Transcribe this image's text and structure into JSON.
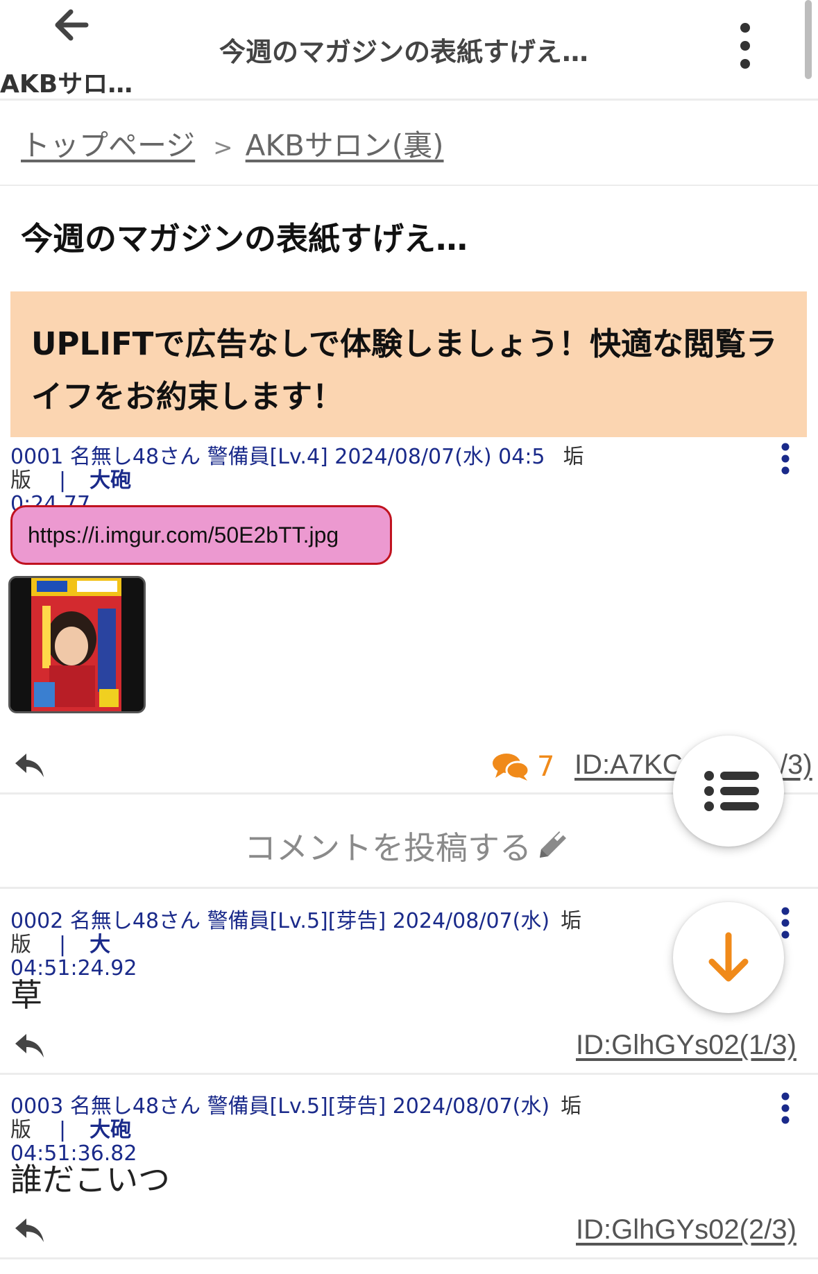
{
  "header": {
    "back_label": "AKBサロ…",
    "title": "今週のマガジンの表紙すげえ…"
  },
  "breadcrumb": {
    "home": "トップページ",
    "separator": ">",
    "board": "AKBサロン(裏)"
  },
  "thread": {
    "title": "今週のマガジンの表紙すげえ…"
  },
  "ad": {
    "text": "UPLIFTで広告なしで体験しましょう！快適な閲覧ライフをお約束します！"
  },
  "posts": [
    {
      "meta_line1": "0001 名無し48さん 警備員[Lv.4] 2024/08/07(水) 04:5",
      "meta_line2": "0:24.77",
      "ban": "垢版",
      "pipe": "|",
      "cannon": "大砲",
      "link": "https://i.imgur.com/50E2bTT.jpg",
      "comment_count": "7",
      "id": "ID:A7KC",
      "id_suffix": "/3)"
    },
    {
      "meta_line1": "0002 名無し48さん 警備員[Lv.5][芽告] 2024/08/07(水)",
      "meta_line2": "04:51:24.92",
      "ban": "垢版",
      "pipe": "|",
      "cannon": "大",
      "body": "草",
      "id": "ID:GlhGYs02(1/3)"
    },
    {
      "meta_line1": "0003 名無し48さん 警備員[Lv.5][芽告] 2024/08/07(水)",
      "meta_line2": "04:51:36.82",
      "ban": "垢版",
      "pipe": "|",
      "cannon": "大砲",
      "body": "誰だこいつ",
      "id": "ID:GlhGYs02(2/3)"
    }
  ],
  "comment_cta": "コメントを投稿する",
  "icons": {
    "back": "arrow-left-icon",
    "more": "kebab-vertical-icon",
    "reply": "reply-icon",
    "comments": "chat-bubbles-icon",
    "pencil": "pencil-icon",
    "list": "list-icon",
    "down": "arrow-down-icon"
  },
  "colors": {
    "ad_bg": "#fbd5b1",
    "link_pill_bg": "#ec99d0",
    "link_pill_border": "#c0121f",
    "meta_text": "#1a2a8a",
    "accent_orange": "#f08a1a"
  }
}
